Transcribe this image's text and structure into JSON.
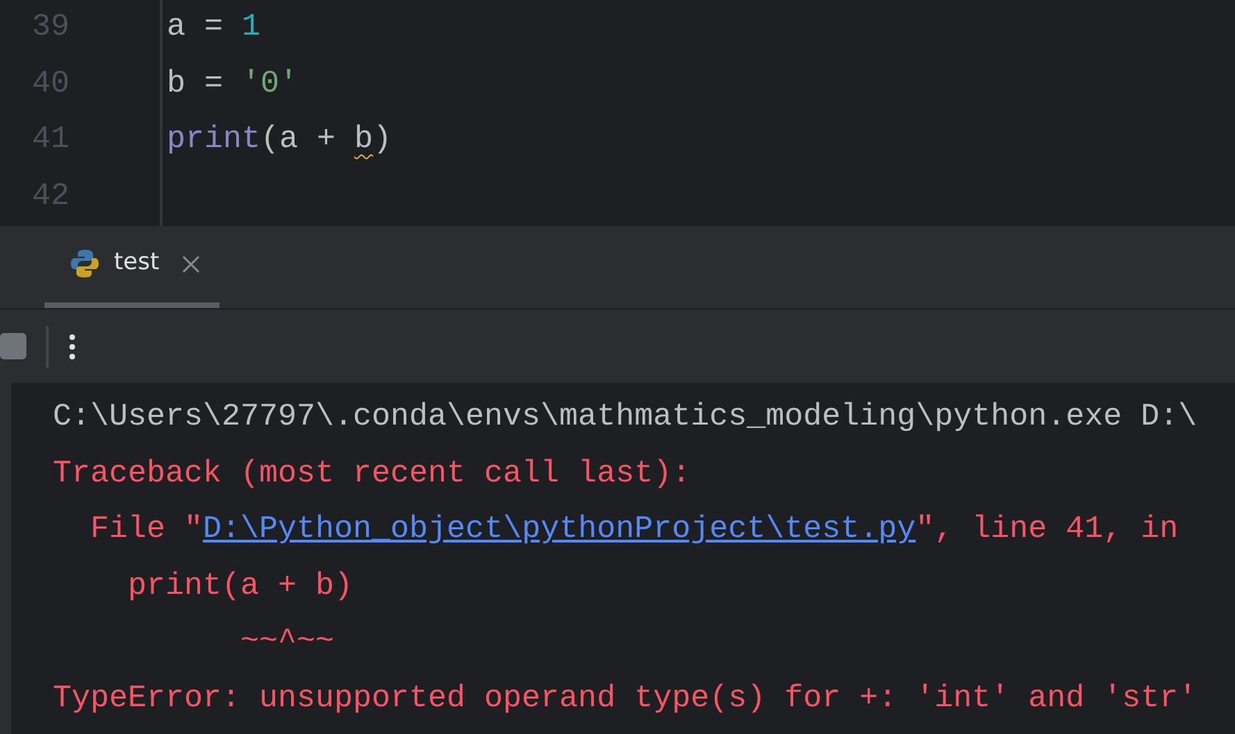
{
  "editor": {
    "lines": [
      {
        "number": "39",
        "tokens": [
          {
            "kind": "text",
            "text": "a = "
          },
          {
            "kind": "number",
            "text": "1"
          }
        ]
      },
      {
        "number": "40",
        "tokens": [
          {
            "kind": "text",
            "text": "b = "
          },
          {
            "kind": "string",
            "text": "'0'"
          }
        ]
      },
      {
        "number": "41",
        "tokens": [
          {
            "kind": "builtin",
            "text": "print"
          },
          {
            "kind": "text",
            "text": "(a + "
          },
          {
            "kind": "text",
            "text": "b",
            "warning": true
          },
          {
            "kind": "text",
            "text": ")"
          }
        ]
      },
      {
        "number": "42"
      }
    ]
  },
  "run_panel": {
    "tabs": [
      {
        "label": "test",
        "selected": true
      }
    ],
    "console": [
      {
        "kind": "command",
        "parts": [
          {
            "text": "C:\\Users\\27797\\.conda\\envs\\mathmatics_modeling\\python.exe D:\\"
          }
        ]
      },
      {
        "kind": "error",
        "parts": [
          {
            "text": "Traceback (most recent call last):"
          }
        ]
      },
      {
        "kind": "error",
        "parts": [
          {
            "text": "  File \""
          },
          {
            "text": "D:\\Python_object\\pythonProject\\test.py",
            "link": true
          },
          {
            "text": "\", line 41, in"
          }
        ]
      },
      {
        "kind": "error",
        "parts": [
          {
            "text": "    print(a + b)"
          }
        ]
      },
      {
        "kind": "error",
        "parts": [
          {
            "text": "          ~~^~~"
          }
        ]
      },
      {
        "kind": "error",
        "parts": [
          {
            "text": "TypeError: unsupported operand type(s) for +: 'int' and 'str'"
          }
        ]
      }
    ]
  }
}
